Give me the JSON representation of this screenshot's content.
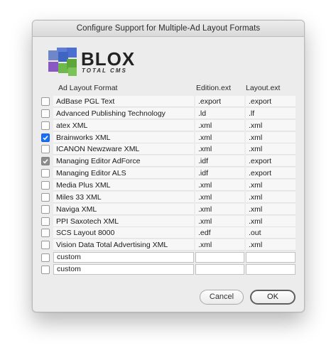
{
  "window": {
    "title": "Configure Support for Multiple-Ad Layout Formats"
  },
  "logo": {
    "name": "BLOX",
    "subtitle": "TOTAL CMS"
  },
  "columns": {
    "format": "Ad Layout Format",
    "edition": "Edition.ext",
    "layout": "Layout.ext"
  },
  "formats": [
    {
      "name": "AdBase PGL Text",
      "edition": ".export",
      "layout": ".export",
      "checked": "none"
    },
    {
      "name": "Advanced Publishing Technology",
      "edition": ".ld",
      "layout": ".lf",
      "checked": "none"
    },
    {
      "name": "atex XML",
      "edition": ".xml",
      "layout": ".xml",
      "checked": "none"
    },
    {
      "name": "Brainworks XML",
      "edition": ".xml",
      "layout": ".xml",
      "checked": "blue"
    },
    {
      "name": "ICANON Newzware XML",
      "edition": ".xml",
      "layout": ".xml",
      "checked": "none"
    },
    {
      "name": "Managing Editor AdForce",
      "edition": ".idf",
      "layout": ".export",
      "checked": "grey"
    },
    {
      "name": "Managing Editor ALS",
      "edition": ".idf",
      "layout": ".export",
      "checked": "none"
    },
    {
      "name": "Media Plus XML",
      "edition": ".xml",
      "layout": ".xml",
      "checked": "none"
    },
    {
      "name": "Miles 33 XML",
      "edition": ".xml",
      "layout": ".xml",
      "checked": "none"
    },
    {
      "name": "Naviga XML",
      "edition": ".xml",
      "layout": ".xml",
      "checked": "none"
    },
    {
      "name": "PPI Saxotech XML",
      "edition": ".xml",
      "layout": ".xml",
      "checked": "none"
    },
    {
      "name": "SCS Layout 8000",
      "edition": ".edf",
      "layout": ".out",
      "checked": "none"
    },
    {
      "name": "Vision Data Total Advertising XML",
      "edition": ".xml",
      "layout": ".xml",
      "checked": "none"
    }
  ],
  "custom_rows": [
    {
      "name": "custom",
      "edition": "",
      "layout": ""
    },
    {
      "name": "custom",
      "edition": "",
      "layout": ""
    }
  ],
  "buttons": {
    "cancel": "Cancel",
    "ok": "OK"
  },
  "colors": {
    "checkbox_accent": "#1a6ef5",
    "checkbox_disabled": "#8d8d8d"
  }
}
